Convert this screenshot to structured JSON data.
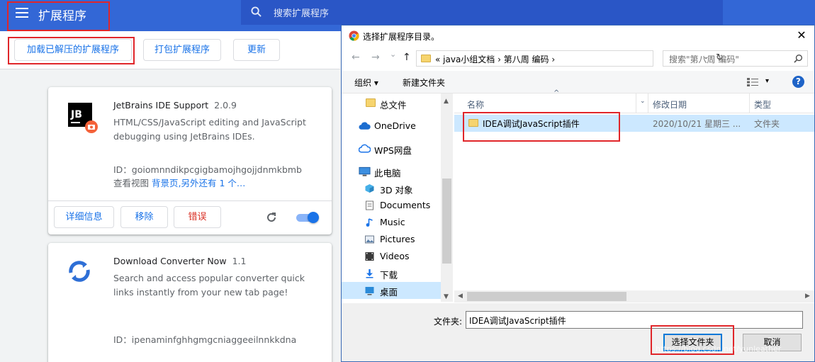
{
  "page": {
    "title": "扩展程序",
    "search_placeholder": "搜索扩展程序",
    "toolbar": {
      "load_unpacked": "加载已解压的扩展程序",
      "pack": "打包扩展程序",
      "update": "更新"
    }
  },
  "extensions": [
    {
      "name": "JetBrains IDE Support",
      "version": "2.0.9",
      "description": "HTML/CSS/JavaScript editing and JavaScript debugging using JetBrains IDEs.",
      "id": "ID：goiomnndikpcgigbamojhgojjdnmkbmb",
      "views_prefix": "查看视图",
      "views_link": "背景页,另外还有 1 个…",
      "details_label": "详细信息",
      "remove_label": "移除",
      "errors_label": "错误",
      "enabled": true
    },
    {
      "name": "Download Converter Now",
      "version": "1.1",
      "description": "Search and access popular converter quick links instantly from your new tab page!",
      "id": "ID：ipenaminfghhgmgcniaggeeilnnkkdna"
    }
  ],
  "dialog": {
    "title": "选择扩展程序目录。",
    "close_glyph": "✕",
    "nav": {
      "back": "←",
      "forward": "→",
      "down": "⌄",
      "up": "↑"
    },
    "address": "« java小组文档 › 第八周 编码 ›",
    "address_drop": "⌄",
    "refresh_glyph": "↻",
    "search_placeholder": "搜索\"第八周 编码\"",
    "organize": "组织 ▾",
    "new_folder": "新建文件夹",
    "view_drop": "▾",
    "help": "?",
    "nav_items": [
      {
        "label": "总文件",
        "icon": "folder-icon"
      },
      {
        "label": "OneDrive",
        "icon": "cloud-icon"
      },
      {
        "label": "WPS网盘",
        "icon": "wps-cloud-icon"
      },
      {
        "label": "此电脑",
        "icon": "computer-icon"
      },
      {
        "label": "3D 对象",
        "icon": "cube-icon"
      },
      {
        "label": "Documents",
        "icon": "document-icon"
      },
      {
        "label": "Music",
        "icon": "music-icon"
      },
      {
        "label": "Pictures",
        "icon": "picture-icon"
      },
      {
        "label": "Videos",
        "icon": "video-icon"
      },
      {
        "label": "下载",
        "icon": "download-icon"
      },
      {
        "label": "桌面",
        "icon": "desktop-icon",
        "selected": true
      }
    ],
    "columns": {
      "name": "名称",
      "date": "修改日期",
      "type": "类型"
    },
    "files": [
      {
        "name": "IDEA调试JavaScript插件",
        "date": "2020/10/21 星期三 ...",
        "type": "文件夹"
      }
    ],
    "folder_label": "文件夹:",
    "folder_value": "IDEA调试JavaScript插件",
    "select_button": "选择文件夹",
    "cancel_button": "取消",
    "scroll": {
      "up": "▲",
      "down": "▼",
      "left": "◀",
      "right": "▶",
      "sort": "^"
    }
  },
  "watermark": "https://blog.csdn.net/yunleather",
  "colors": {
    "brand": "#3367d6",
    "accent": "#1a73e8",
    "highlight": "#e0262a",
    "selection": "#cce8ff"
  }
}
